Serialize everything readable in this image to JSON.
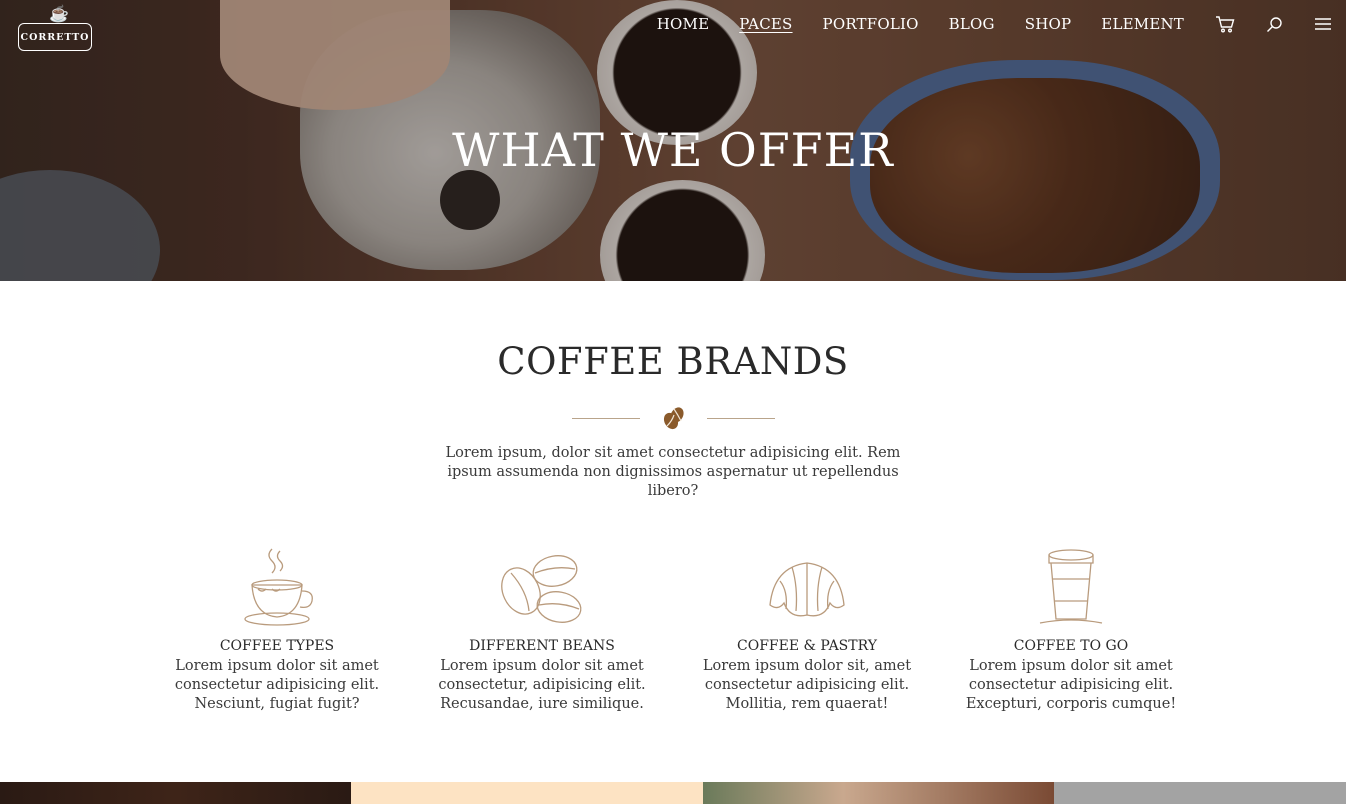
{
  "brand": {
    "name": "CORRETTO"
  },
  "nav": {
    "items": [
      {
        "label": "HOME",
        "active": false
      },
      {
        "label": "PACES",
        "active": true
      },
      {
        "label": "PORTFOLIO",
        "active": false
      },
      {
        "label": "BLOG",
        "active": false
      },
      {
        "label": "SHOP",
        "active": false
      },
      {
        "label": "ELEMENT",
        "active": false
      }
    ],
    "icons": [
      "cart-icon",
      "search-icon",
      "menu-icon"
    ]
  },
  "hero": {
    "title": "WHAT WE OFFER"
  },
  "section": {
    "title": "COFFEE BRANDS",
    "intro": "Lorem ipsum, dolor sit amet consectetur adipisicing elit. Rem ipsum assumenda non dignissimos aspernatur ut repellendus libero?"
  },
  "features": [
    {
      "title": "COFFEE TYPES",
      "line1": "Lorem ipsum dolor sit amet",
      "line2": "consectetur adipisicing elit.",
      "line3": "Nesciunt, fugiat fugit?"
    },
    {
      "title": "DIFFERENT BEANS",
      "line1": "Lorem ipsum dolor sit amet",
      "line2": "consectetur, adipisicing elit.",
      "line3": "Recusandae, iure similique."
    },
    {
      "title": "COFFEE & PASTRY",
      "line1": "Lorem ipsum dolor sit, amet",
      "line2": "consectetur adipisicing elit.",
      "line3": "Mollitia, rem quaerat!"
    },
    {
      "title": "COFFEE TO GO",
      "line1": "Lorem ipsum dolor sit amet",
      "line2": "consectetur adipisicing elit.",
      "line3": "Excepturi, corporis cumque!"
    }
  ],
  "colors": {
    "accent": "#8a5a2b",
    "illustration": "#b99b7d",
    "hero_tint": "#5a3c2c"
  }
}
